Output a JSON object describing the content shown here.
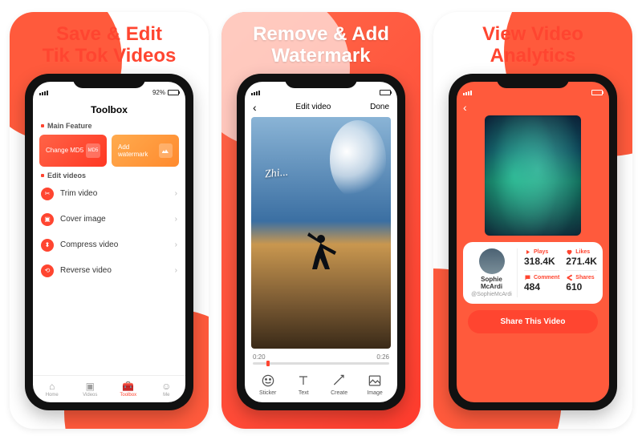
{
  "panel1": {
    "headline": "Save & Edit\nTik Tok Videos",
    "status": {
      "left_signal": "signal",
      "right_battery": "92%"
    },
    "toolbox_title": "Toolbox",
    "section_main": "Main Feature",
    "feature_md5": "Change MD5",
    "feature_md5_badge": "MD5",
    "feature_watermark": "Add watermark",
    "section_edit": "Edit videos",
    "tool_trim": "Trim video",
    "tool_cover": "Cover image",
    "tool_compress": "Compress video",
    "tool_reverse": "Reverse video",
    "tabs": {
      "home": "Home",
      "videos": "Videos",
      "toolbox": "Toolbox",
      "me": "Me"
    }
  },
  "panel2": {
    "headline": "Remove & Add\nWatermark",
    "nav_back": "‹",
    "nav_title": "Edit video",
    "nav_done": "Done",
    "time_from": "0:20",
    "time_to": "0:26",
    "signature": "Zhi...",
    "tools": {
      "sticker": "Sticker",
      "text": "Text",
      "create": "Create",
      "image": "Image"
    }
  },
  "panel3": {
    "headline": "View Video\nAnalytics",
    "back": "‹",
    "user_name": "Sophie McArdi",
    "user_handle": "@SophieMcArdi",
    "metrics": {
      "plays_label": "Plays",
      "plays_value": "318.4K",
      "likes_label": "Likes",
      "likes_value": "271.4K",
      "comment_label": "Comment",
      "comment_value": "484",
      "shares_label": "Shares",
      "shares_value": "610"
    },
    "share_button": "Share This Video"
  }
}
